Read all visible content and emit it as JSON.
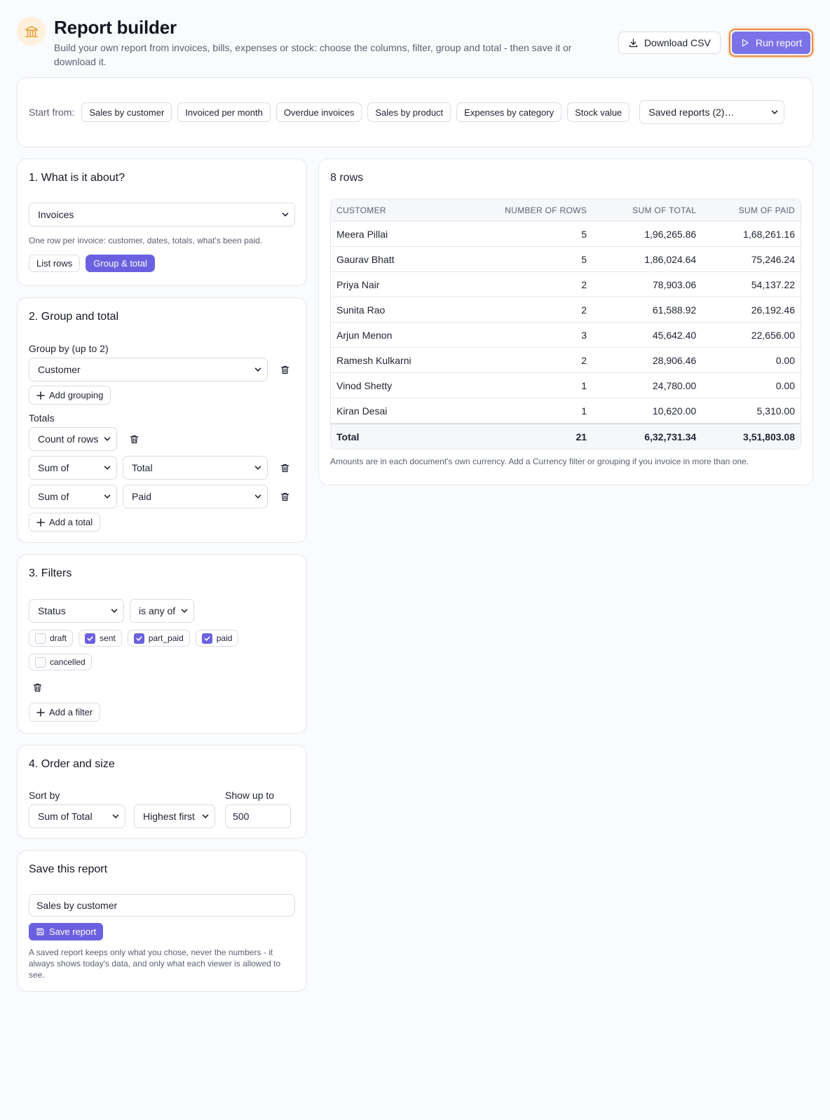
{
  "header": {
    "title": "Report builder",
    "subtitle": "Build your own report from invoices, bills, expenses or stock: choose the columns, filter, group and total - then save it or download it.",
    "download_label": "Download CSV",
    "run_label": "Run report"
  },
  "presets": {
    "label": "Start from:",
    "items": [
      "Sales by customer",
      "Invoiced per month",
      "Overdue invoices",
      "Sales by product",
      "Expenses by category",
      "Stock value"
    ],
    "saved_select": "Saved reports (2)…"
  },
  "section1": {
    "title": "1. What is it about?",
    "source_value": "Invoices",
    "hint": "One row per invoice: customer, dates, totals, what's been paid.",
    "modes": [
      "List rows",
      "Group & total"
    ],
    "active_mode": 1
  },
  "section2": {
    "title": "2. Group and total",
    "group_label": "Group by (up to 2)",
    "group_value": "Customer",
    "add_grouping": "Add grouping",
    "totals_label": "Totals",
    "count_value": "Count of rows",
    "sum1_agg": "Sum of",
    "sum1_field": "Total",
    "sum2_agg": "Sum of",
    "sum2_field": "Paid",
    "add_total": "Add a total"
  },
  "section3": {
    "title": "3. Filters",
    "field_value": "Status",
    "op_value": "is any of",
    "options": [
      {
        "label": "draft",
        "checked": false
      },
      {
        "label": "sent",
        "checked": true
      },
      {
        "label": "part_paid",
        "checked": true
      },
      {
        "label": "paid",
        "checked": true
      },
      {
        "label": "cancelled",
        "checked": false
      }
    ],
    "add_filter": "Add a filter"
  },
  "section4": {
    "title": "4. Order and size",
    "sort_label": "Sort by",
    "sort_value": "Sum of Total",
    "dir_value": "Highest first",
    "limit_label": "Show up to",
    "limit_value": "500"
  },
  "save": {
    "title": "Save this report",
    "name_value": "Sales by customer",
    "button": "Save report",
    "note": "A saved report keeps only what you chose, never the numbers - it always shows today's data, and only what each viewer is allowed to see."
  },
  "results": {
    "title": "8 rows",
    "columns": [
      "CUSTOMER",
      "NUMBER OF ROWS",
      "SUM OF TOTAL",
      "SUM OF PAID"
    ],
    "rows": [
      [
        "Meera Pillai",
        "5",
        "1,96,265.86",
        "1,68,261.16"
      ],
      [
        "Gaurav Bhatt",
        "5",
        "1,86,024.64",
        "75,246.24"
      ],
      [
        "Priya Nair",
        "2",
        "78,903.06",
        "54,137.22"
      ],
      [
        "Sunita Rao",
        "2",
        "61,588.92",
        "26,192.46"
      ],
      [
        "Arjun Menon",
        "3",
        "45,642.40",
        "22,656.00"
      ],
      [
        "Ramesh Kulkarni",
        "2",
        "28,906.46",
        "0.00"
      ],
      [
        "Vinod Shetty",
        "1",
        "24,780.00",
        "0.00"
      ],
      [
        "Kiran Desai",
        "1",
        "10,620.00",
        "5,310.00"
      ]
    ],
    "total_row": [
      "Total",
      "21",
      "6,32,731.34",
      "3,51,803.08"
    ],
    "note": "Amounts are in each document's own currency. Add a Currency filter or grouping if you invoice in more than one."
  },
  "colors": {
    "accent": "#6b61e0",
    "run": "#7b72e8",
    "focus_ring": "#f08a3c",
    "logo_bg": "#fdf1dd",
    "logo": "#e9a23b"
  }
}
